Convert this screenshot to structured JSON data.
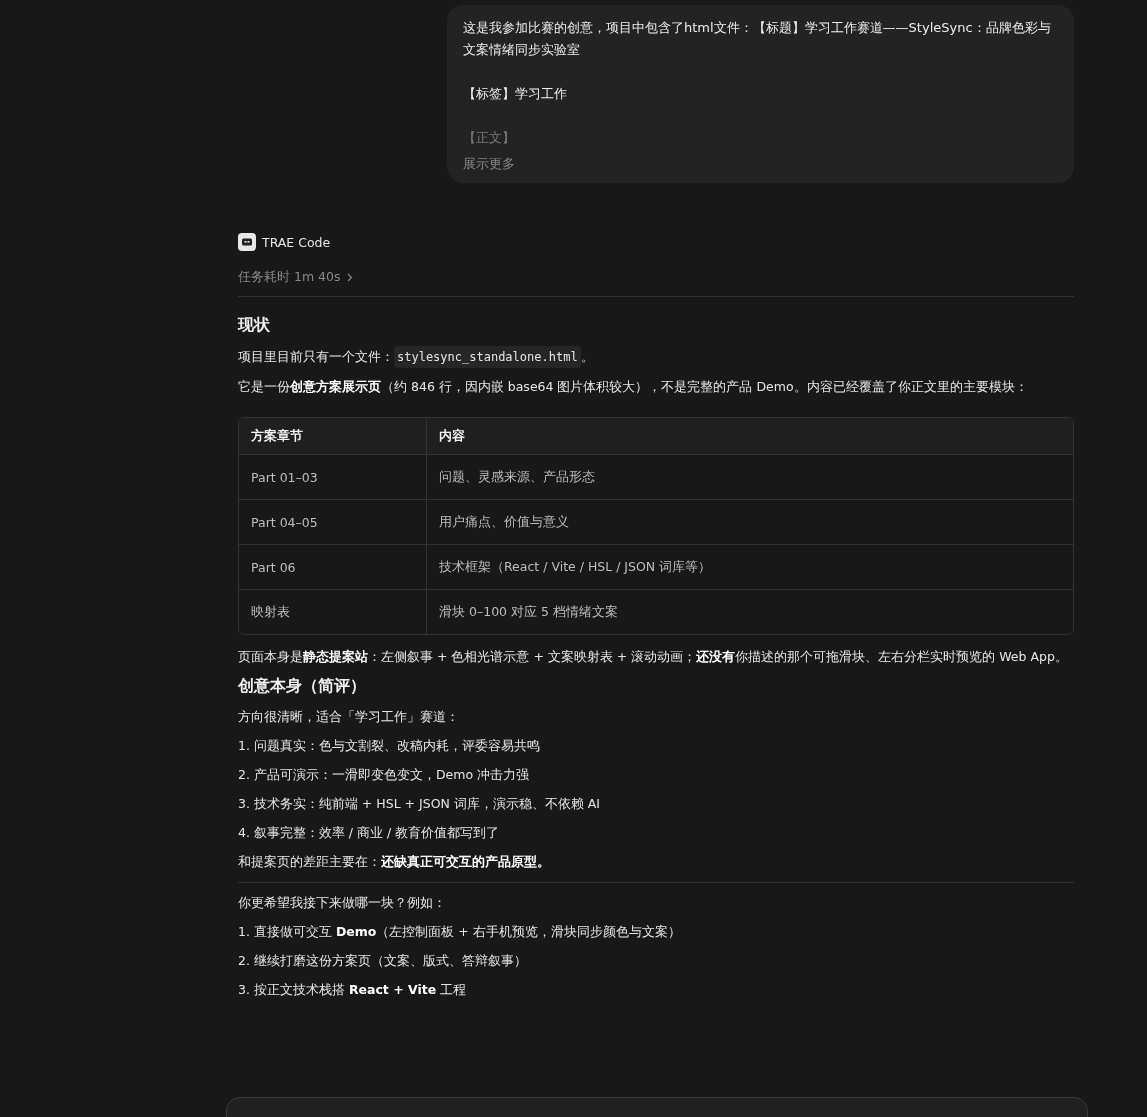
{
  "user_message": {
    "lines": [
      "这是我参加比赛的创意，项目中包含了html文件：【标题】学习工作赛道——StyleSync：品牌色彩与文案情绪同步实验室",
      "【标签】学习工作",
      "【正文】"
    ],
    "expand_link": "展示更多"
  },
  "assistant": {
    "name": "TRAE Code",
    "duration": "任务耗时 1m 40s",
    "expanded": false
  },
  "blocks": [
    {
      "kind": "heading",
      "text": "现状"
    },
    {
      "kind": "para_code",
      "before": "项目里目前只有一个文件：",
      "code": "stylesync_standalone.html",
      "after": "。"
    },
    {
      "kind": "para",
      "text": "它是一份**创意方案展示页**（约 846 行，因内嵌 base64 图片体积较大），不是完整的产品 Demo。内容已经覆盖了你正文里的主要模块："
    },
    {
      "kind": "table",
      "columns": [
        "方案章节",
        "内容"
      ],
      "rows": [
        [
          "Part 01–03",
          "问题、灵感来源、产品形态"
        ],
        [
          "Part 04–05",
          "用户痛点、价值与意义"
        ],
        [
          "Part 06",
          "技术框架（React / Vite / HSL / JSON 词库等）"
        ],
        [
          "映射表",
          "滑块 0–100 对应 5 档情绪文案"
        ]
      ]
    },
    {
      "kind": "para",
      "text": "页面本身是**静态提案站**：左侧叙事 + 色相光谱示意 + 文案映射表 + 滚动动画；**还没有**你描述的那个可拖滑块、左右分栏实时预览的 Web App。"
    },
    {
      "kind": "heading",
      "text": "创意本身（简评）"
    },
    {
      "kind": "para",
      "text": "方向很清晰，适合「学习工作」赛道："
    },
    {
      "kind": "list",
      "items": [
        "1. 问题真实：色与文割裂、改稿内耗，评委容易共鸣",
        "2. 产品可演示：一滑即变色变文，Demo 冲击力强",
        "3. 技术务实：纯前端 + HSL + JSON 词库，演示稳、不依赖 AI",
        "4. 叙事完整：效率 / 商业 / 教育价值都写到了"
      ]
    },
    {
      "kind": "para",
      "text": "和提案页的差距主要在：**还缺真正可交互的产品原型。**"
    },
    {
      "kind": "rule"
    },
    {
      "kind": "para",
      "text": "你更希望我接下来做哪一块？例如："
    },
    {
      "kind": "list",
      "items": [
        "1. 直接做可交互 **Demo**（左控制面板 + 右手机预览，滑块同步颜色与文案）",
        "2. 继续打磨这份方案页（文案、版式、答辩叙事）",
        "3. 按正文技术栈搭 **React + Vite** 工程"
      ]
    }
  ]
}
